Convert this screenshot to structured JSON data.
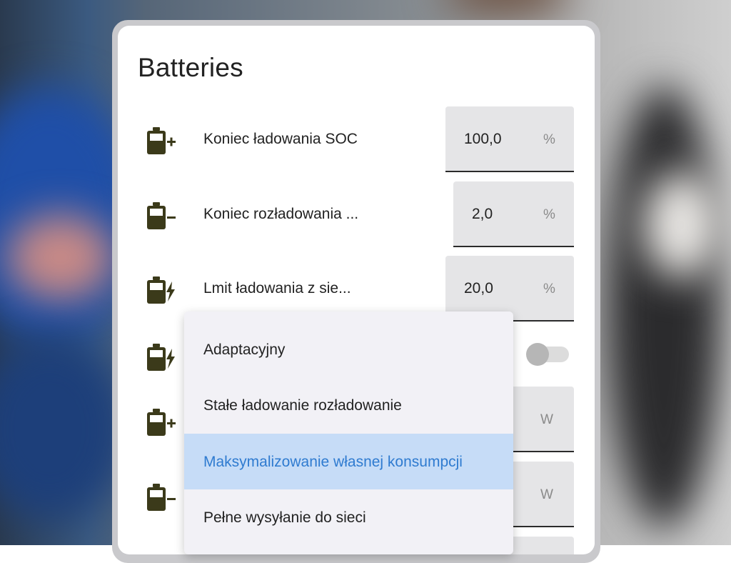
{
  "panel": {
    "title": "Batteries"
  },
  "settings": [
    {
      "label": "Koniec ładowania SOC",
      "value": "100,0",
      "unit": "%",
      "icon": "battery-plus-icon"
    },
    {
      "label": "Koniec rozładowania ...",
      "value": "2,0",
      "unit": "%",
      "icon": "battery-minus-icon"
    },
    {
      "label": "Lmit ładowania z sie...",
      "value": "20,0",
      "unit": "%",
      "icon": "battery-charging-icon"
    },
    {
      "label": "",
      "toggle": false,
      "icon": "battery-charging-icon"
    },
    {
      "label": "",
      "value": "",
      "unit": "W",
      "icon": "battery-plus-icon"
    },
    {
      "label": "",
      "value": "",
      "unit": "W",
      "icon": "battery-minus-icon"
    }
  ],
  "dropdown": {
    "options": [
      "Adaptacyjny",
      "Stałe ładowanie rozładowanie",
      "Maksymalizowanie własnej konsumpcji",
      "Pełne wysyłanie do sieci"
    ],
    "selected_index": 2
  },
  "colors": {
    "icon": "#3b3a1a",
    "accent": "#2f7bd0",
    "selected_bg": "#c6dcf7"
  }
}
